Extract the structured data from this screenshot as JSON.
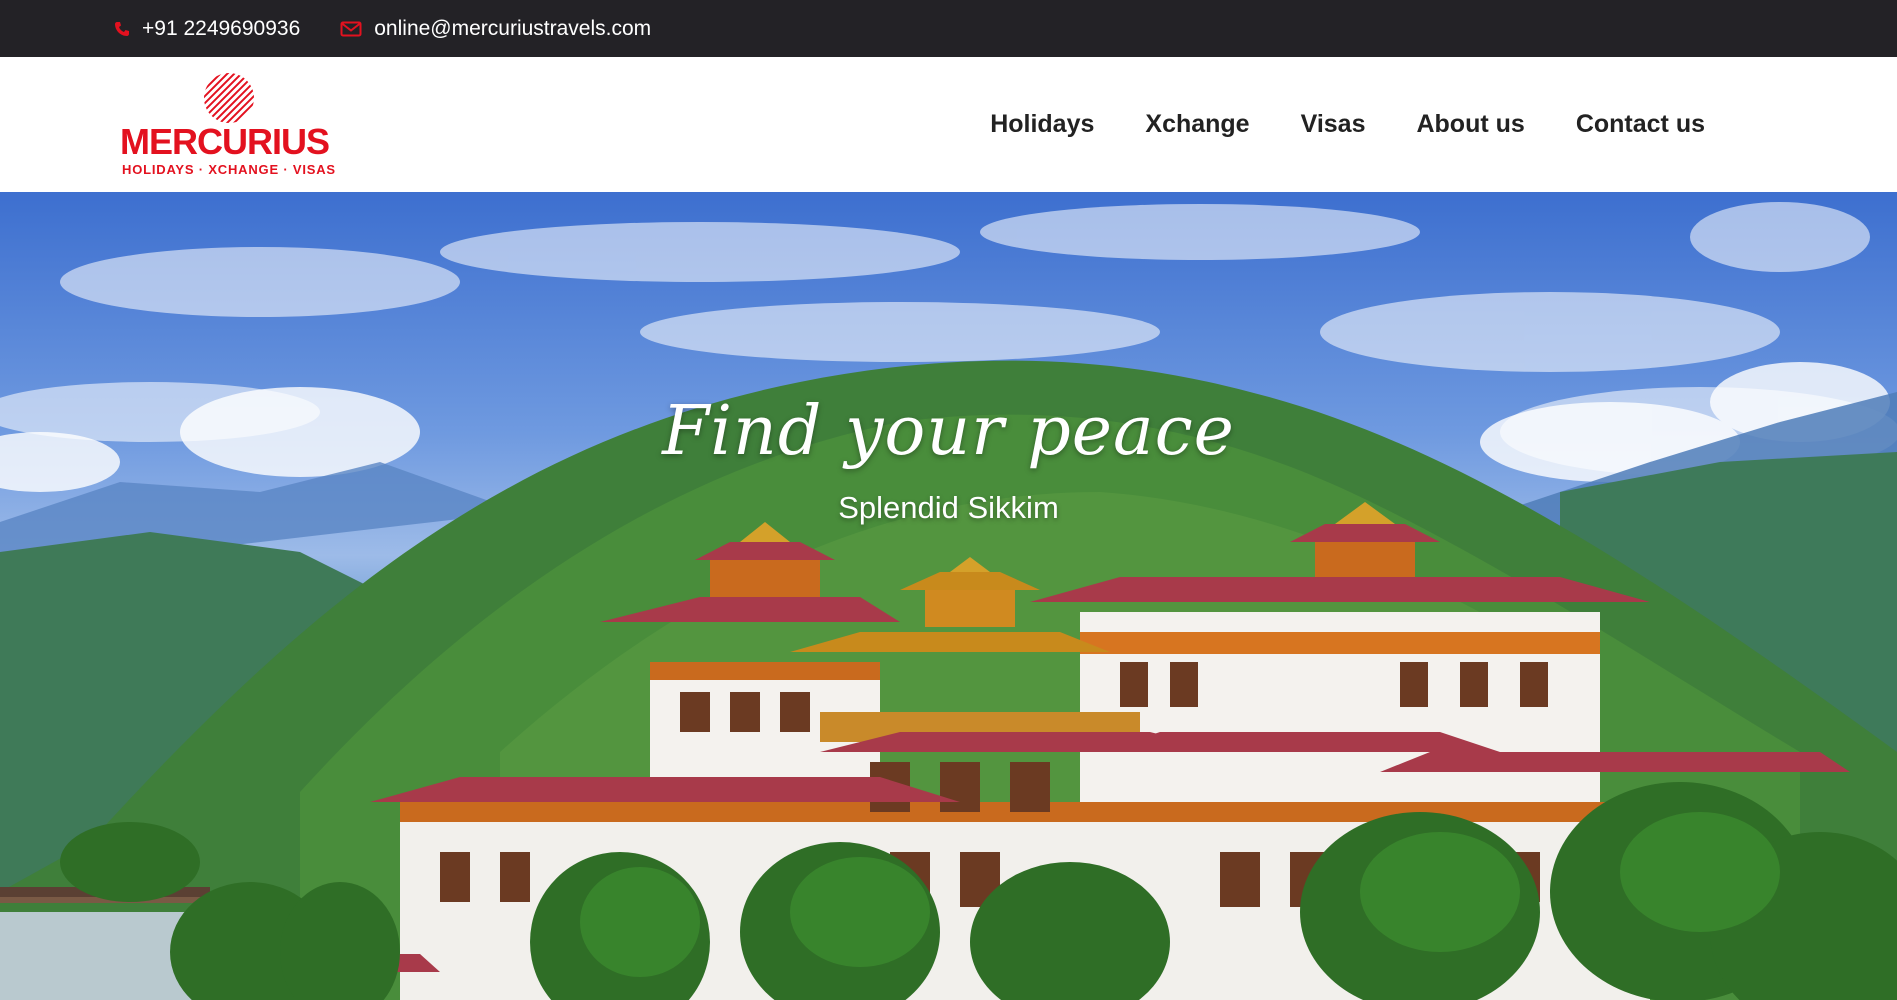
{
  "topbar": {
    "phone": "+91 2249690936",
    "email": "online@mercuriustravels.com"
  },
  "brand": {
    "name": "MERCURIUS",
    "tagline": "HOLIDAYS · XCHANGE · VISAS",
    "color": "#e3111f"
  },
  "nav": {
    "items": [
      "Holidays",
      "Xchange",
      "Visas",
      "About us",
      "Contact us"
    ]
  },
  "hero": {
    "title": "Find your peace",
    "subtitle": "Splendid Sikkim"
  }
}
